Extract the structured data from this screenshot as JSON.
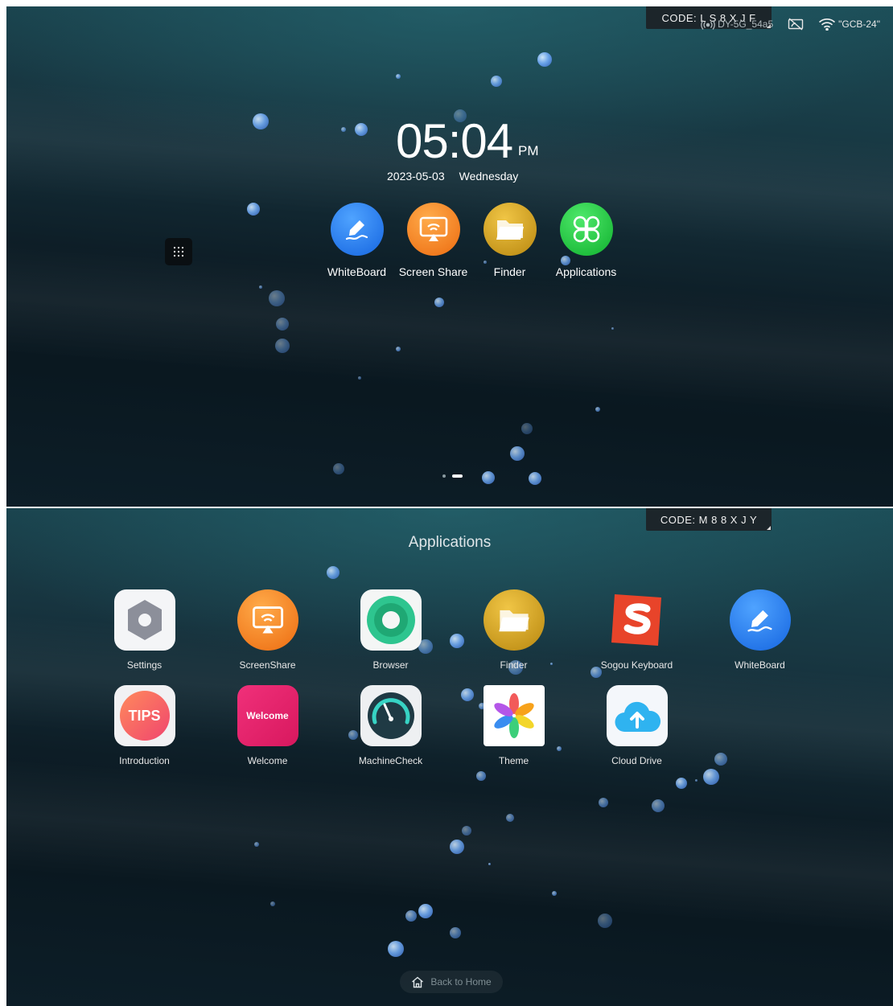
{
  "home_screen": {
    "code_badge": "CODE: L S 8 X J F",
    "status_bar": {
      "hotspot_name": "DY-5G_54a5",
      "wifi_name": "\"GCB-24\""
    },
    "clock": {
      "time": "05:04",
      "ampm": "PM",
      "date": "2023-05-03",
      "weekday": "Wednesday"
    },
    "dock_apps": [
      {
        "label": "WhiteBoard",
        "icon": "whiteboard-pen-icon",
        "color": "#1f78e8"
      },
      {
        "label": "Screen Share",
        "icon": "screen-share-icon",
        "color": "#f07a19"
      },
      {
        "label": "Finder",
        "icon": "folder-icon",
        "color": "#d19f1f"
      },
      {
        "label": "Applications",
        "icon": "clover-apps-icon",
        "color": "#19c43a"
      }
    ],
    "drawer_button_icon": "grid-dots-icon",
    "pager": {
      "pages": 2,
      "active": 2
    }
  },
  "apps_screen": {
    "code_badge": "CODE: M 8 8 X J Y",
    "title": "Applications",
    "apps": [
      {
        "label": "Settings",
        "icon": "settings-gear-icon"
      },
      {
        "label": "ScreenShare",
        "icon": "screen-share-icon"
      },
      {
        "label": "Browser",
        "icon": "browser-icon"
      },
      {
        "label": "Finder",
        "icon": "folder-icon"
      },
      {
        "label": "Sogou Keyboard",
        "icon": "sogou-s-icon"
      },
      {
        "label": "WhiteBoard",
        "icon": "whiteboard-pen-icon"
      },
      {
        "label": "Introduction",
        "icon": "tips-icon",
        "icon_text": "TIPS"
      },
      {
        "label": "Welcome",
        "icon": "welcome-icon",
        "icon_text": "Welcome"
      },
      {
        "label": "MachineCheck",
        "icon": "speedometer-icon"
      },
      {
        "label": "Theme",
        "icon": "theme-petals-icon"
      },
      {
        "label": "Cloud Drive",
        "icon": "cloud-upload-icon"
      }
    ],
    "back_home_label": "Back to Home"
  },
  "colors": {
    "background_top": "#1c4d57",
    "background_bottom": "#0a1820",
    "badge_bg": "#1c2226"
  }
}
